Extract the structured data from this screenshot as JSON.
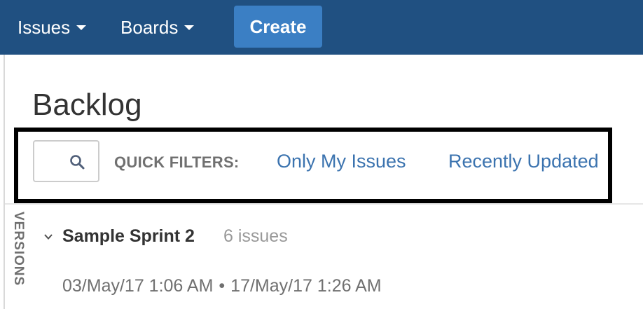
{
  "topnav": {
    "issues_label": "Issues",
    "boards_label": "Boards",
    "create_label": "Create"
  },
  "page": {
    "title": "Backlog"
  },
  "quick_filters": {
    "search_icon": "search-icon",
    "label": "QUICK FILTERS:",
    "filters": [
      "Only My Issues",
      "Recently Updated"
    ]
  },
  "side_tab": {
    "label": "VERSIONS"
  },
  "sprint": {
    "name": "Sample Sprint 2",
    "count": "6 issues",
    "start": "03/May/17 1:06 AM",
    "separator": "•",
    "end": "17/May/17 1:26 AM"
  },
  "colors": {
    "header_bg": "#205081",
    "create_button": "#3b7fc4",
    "link": "#3b73af"
  }
}
